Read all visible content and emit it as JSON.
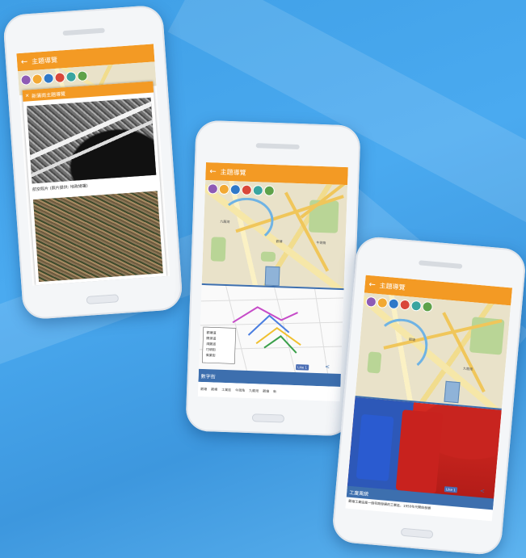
{
  "phone1": {
    "appbar_title": "主題導覽",
    "dialog_title": "新蒲崗主題導覽",
    "photo_caption": "航空照片 (照片提供: 地政總署)",
    "back_icon": "arrow-left-icon"
  },
  "phone2": {
    "appbar_title": "主題導覽",
    "map_labels": [
      "觀塘",
      "九龍灣",
      "牛頭角"
    ],
    "footer_title": "數字街",
    "footer_tabs": [
      "觀塘",
      "觀塘",
      "工業區",
      "牛頭角",
      "九龍灣",
      "觀塘",
      "新"
    ],
    "like_label": "Like 1",
    "legend_lines": [
      "觀塘道",
      "開源道",
      "鴻圖道",
      "巧明街",
      "偉業街"
    ]
  },
  "phone3": {
    "appbar_title": "主題導覽",
    "map_labels": [
      "觀塘",
      "九龍灣"
    ],
    "footer_title": "工廈風貌",
    "footer_text": "觀塘工業區是一個早期發展的工業區，1950年代開始發展",
    "like_label": "Like 1"
  },
  "colors": {
    "appbar": "#f39a24",
    "bluebar": "#3d6fae",
    "background": "#4aaaf0"
  },
  "category_icons": [
    "purple",
    "orange",
    "blue",
    "red",
    "teal",
    "green"
  ]
}
